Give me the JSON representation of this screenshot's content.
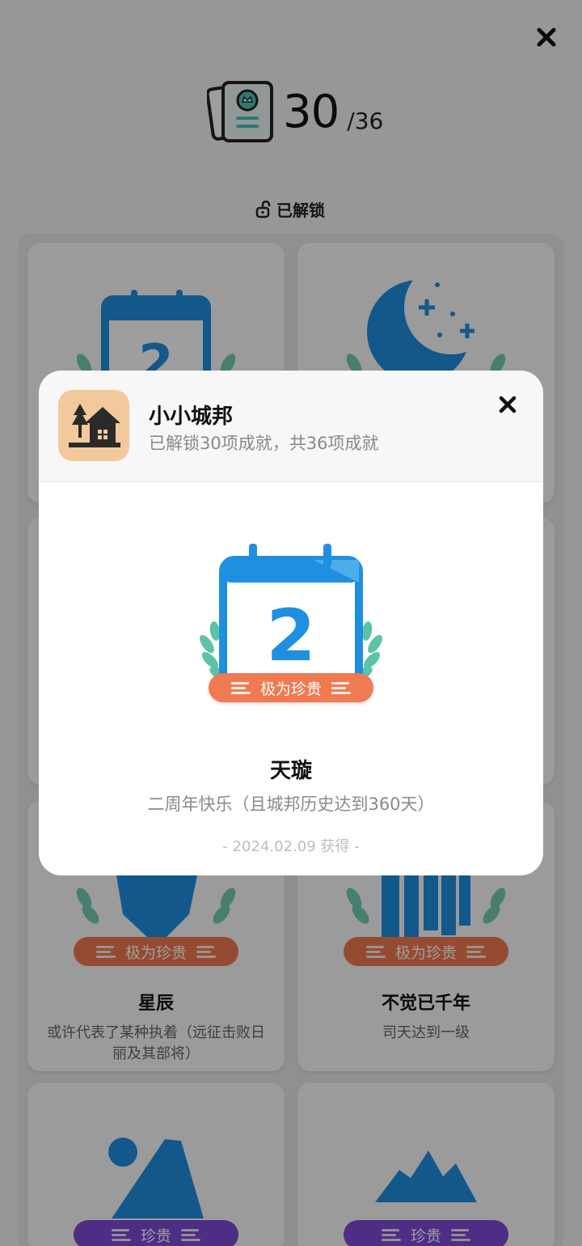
{
  "header": {
    "count_main": "30",
    "count_total": "/36",
    "unlocked_label": "已解锁"
  },
  "cards": [
    {
      "title": "星辰",
      "desc": "或许代表了某种执着（远征击败日丽及其部将）",
      "badge": "极为珍贵"
    },
    {
      "title": "不觉已千年",
      "desc": "司天达到一级",
      "badge": "极为珍贵"
    },
    {
      "badge": "珍贵"
    },
    {
      "badge": "珍贵"
    }
  ],
  "modal": {
    "app_name": "小小城邦",
    "app_sub": "已解锁30项成就，共36项成就",
    "calendar_number": "2",
    "badge": "极为珍贵",
    "achievement_title": "天璇",
    "achievement_desc": "二周年快乐（且城邦历史达到360天）",
    "achievement_date": "- 2024.02.09 获得 -"
  },
  "colors": {
    "accent_blue": "#1f8fe0",
    "rarity_orange": "#f07a51",
    "rarity_purple": "#7d4bd6",
    "laurel_green": "#5cc3a8"
  }
}
